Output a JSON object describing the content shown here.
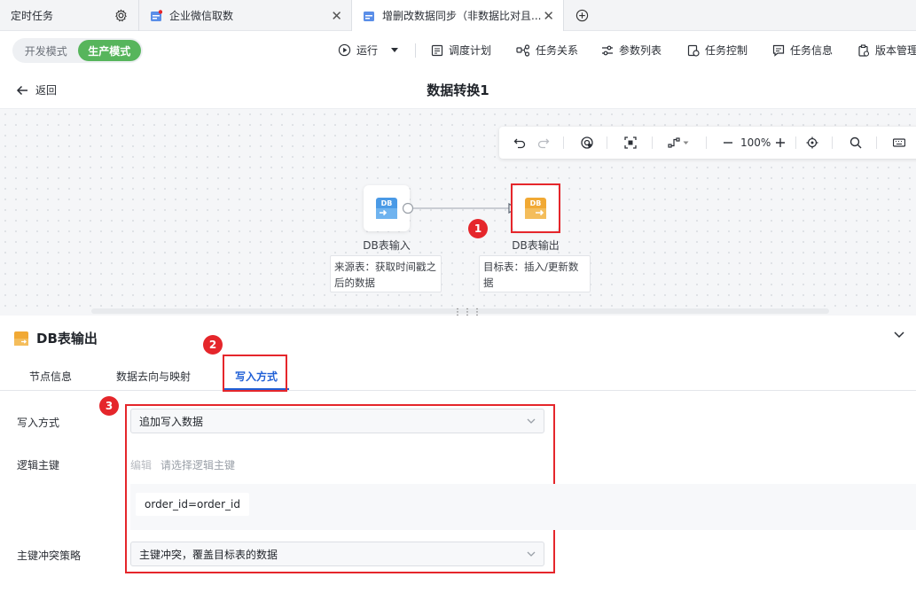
{
  "tabs": [
    {
      "label": "定时任务"
    },
    {
      "label": "企业微信取数"
    },
    {
      "label": "增删改数据同步（非数据比对且..."
    }
  ],
  "toolbar": {
    "modes": [
      "开发模式",
      "生产模式"
    ],
    "active_mode": "生产模式",
    "run": "运行",
    "schedule": "调度计划",
    "relations": "任务关系",
    "params": "参数列表",
    "control": "任务控制",
    "info": "任务信息",
    "version": "版本管理"
  },
  "header": {
    "back": "返回",
    "title": "数据转换1"
  },
  "canvas": {
    "zoom": "100%",
    "nodes": [
      {
        "icon_text": "DB",
        "label": "DB表输入",
        "desc": "来源表：获取时间戳之后的数据"
      },
      {
        "icon_text": "DB",
        "label": "DB表输出",
        "desc": "目标表：插入/更新数据"
      }
    ],
    "badge1": "1"
  },
  "panel": {
    "title": "DB表输出",
    "tabs": [
      "节点信息",
      "数据去向与映射",
      "写入方式"
    ],
    "active_tab": "写入方式",
    "badge2": "2",
    "badge3": "3",
    "write_mode_label": "写入方式",
    "write_mode_value": "追加写入数据",
    "logic_key_label": "逻辑主键",
    "logic_key_edit": "编辑",
    "logic_key_placeholder": "请选择逻辑主键",
    "logic_key_value": "order_id=order_id",
    "conflict_label": "主键冲突策略",
    "conflict_value": "主键冲突，覆盖目标表的数据"
  },
  "colors": {
    "accent": "#1f5fd6",
    "green": "#57b55c",
    "annotation_red": "#e5262b"
  }
}
